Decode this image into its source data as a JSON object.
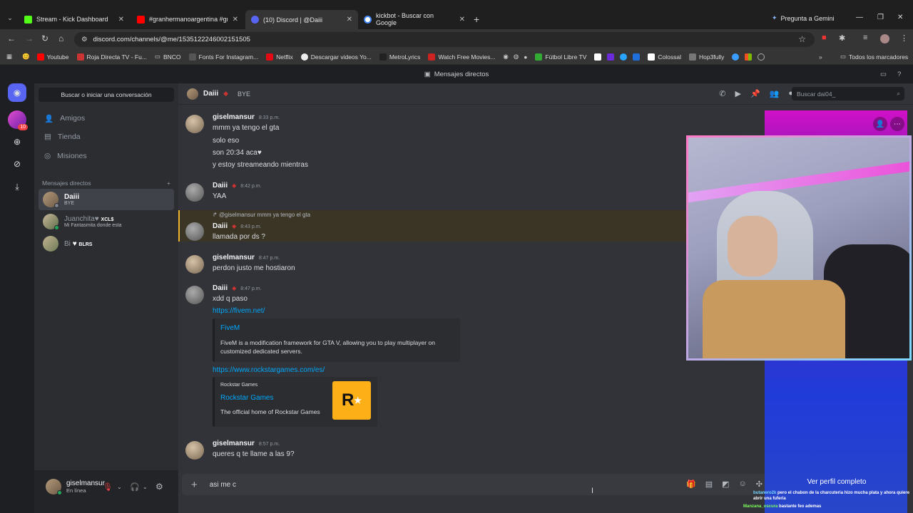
{
  "browser": {
    "tabs": [
      {
        "title": "Stream - Kick Dashboard",
        "color": "#53fc18"
      },
      {
        "title": "#granhermanoargentina #grant",
        "color": "#ff0000"
      },
      {
        "title": "(10) Discord | @Daiii",
        "color": "#5865f2"
      },
      {
        "title": "kickbot - Buscar con Google",
        "color": "#4285f4"
      }
    ],
    "gemini": "Pregunta a Gemini",
    "url": "discord.com/channels/@me/1535122246002151505",
    "bookmarks": [
      "Youtube",
      "Roja Directa TV - Fu...",
      "BNCO",
      "Fonts For Instagram...",
      "Netflix",
      "Descargar videos Yo...",
      "MetroLyrics",
      "Watch Free Movies...",
      "Fútbol Libre TV",
      "Colossal",
      "Hop3fully"
    ],
    "all_bookmarks": "Todos los marcadores"
  },
  "discord": {
    "title": "Mensajes directos",
    "rail_badge": "10",
    "search_conversation": "Buscar o iniciar una conversación",
    "nav": [
      "Amigos",
      "Tienda",
      "Misiones"
    ],
    "dm_header": "Mensajes directos",
    "dms": [
      {
        "name": "Daiii",
        "sub": "BYE"
      },
      {
        "name": "Juanchita♥",
        "tag": "XCL$",
        "sub": "Mi Fantasmita donde esta"
      },
      {
        "name": "Bi",
        "tag": "BLRS",
        "sub": ""
      }
    ],
    "user": {
      "name": "giselmansur",
      "status": "En línea"
    },
    "channel": {
      "name": "Daiii",
      "status": "BYE",
      "search_placeholder": "Buscar dai04_"
    },
    "messages": [
      {
        "author": "giselmansur",
        "time": "8:33 p.m.",
        "lines": [
          "mmm ya tengo el gta",
          "solo eso",
          "son 20:34 aca♥",
          "y estoy streameando mientras"
        ]
      },
      {
        "author": "Daiii",
        "time": "8:42 p.m.",
        "lines": [
          "YAA"
        ]
      },
      {
        "reply_to": "@giselmansur",
        "reply_text": "mmm ya tengo el gta",
        "author": "Daiii",
        "time": "8:43 p.m.",
        "lines": [
          "llamada por ds ?"
        ]
      },
      {
        "author": "giselmansur",
        "time": "8:47 p.m.",
        "lines": [
          "perdon justo me hostiaron"
        ]
      },
      {
        "author": "Daiii",
        "time": "8:47 p.m.",
        "lines": [
          "xdd q paso"
        ],
        "links": [
          "https://fivem.net/",
          "https://www.rockstargames.com/es/"
        ]
      },
      {
        "author": "giselmansur",
        "time": "8:57 p.m.",
        "lines": [
          "queres q te llame a las 9?"
        ]
      }
    ],
    "embeds": [
      {
        "title": "FiveM",
        "desc": "FiveM is a modification framework for GTA V, allowing you to play multiplayer on customized dedicated servers."
      },
      {
        "provider": "Rockstar Games",
        "title": "Rockstar Games",
        "desc": "The official home of Rockstar Games"
      }
    ],
    "composer_text": "asi me c",
    "profile_button": "Ver perfil completo"
  },
  "overlay_chat": [
    {
      "user": "butanero2k",
      "text": "pero el chabon de la charcuteria hizo mucha plata y ahora quiere abrir una fuferia"
    },
    {
      "user": "Manzana_oscura",
      "text": "bastante feo ademas"
    }
  ]
}
